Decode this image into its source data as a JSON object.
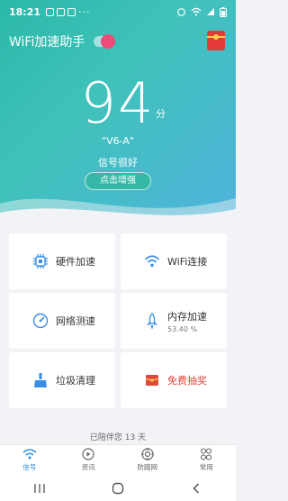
{
  "status_bar": {
    "time": "18:21",
    "more": "···"
  },
  "header": {
    "title": "WiFi加速助手"
  },
  "hero": {
    "score": "94",
    "score_unit": "分",
    "ssid": "\"V6-A\"",
    "signal_text": "信号很好",
    "boost_button": "点击增强"
  },
  "features": [
    {
      "label": "硬件加速",
      "icon": "chip-icon"
    },
    {
      "label": "WiFi连接",
      "icon": "wifi-icon"
    },
    {
      "label": "网络测速",
      "icon": "speedometer-icon"
    },
    {
      "label": "内存加速",
      "sub": "53.40 %",
      "icon": "rocket-icon"
    },
    {
      "label": "垃圾清理",
      "icon": "broom-icon"
    },
    {
      "label": "免费抽奖",
      "icon": "red-envelope-icon",
      "color": "#e0463e"
    }
  ],
  "companion": {
    "text": "已陪伴您",
    "days": "13",
    "unit": "天"
  },
  "tabs": [
    {
      "label": "信号",
      "icon": "wifi-icon",
      "active": true
    },
    {
      "label": "资讯",
      "icon": "play-circle-icon"
    },
    {
      "label": "防蹭网",
      "icon": "target-icon"
    },
    {
      "label": "常用",
      "icon": "grid-icon"
    }
  ],
  "colors": {
    "accent": "#2bb8a9",
    "toggle": "#f04a78",
    "active_tab": "#2a8de0",
    "lottery": "#e0463e"
  }
}
